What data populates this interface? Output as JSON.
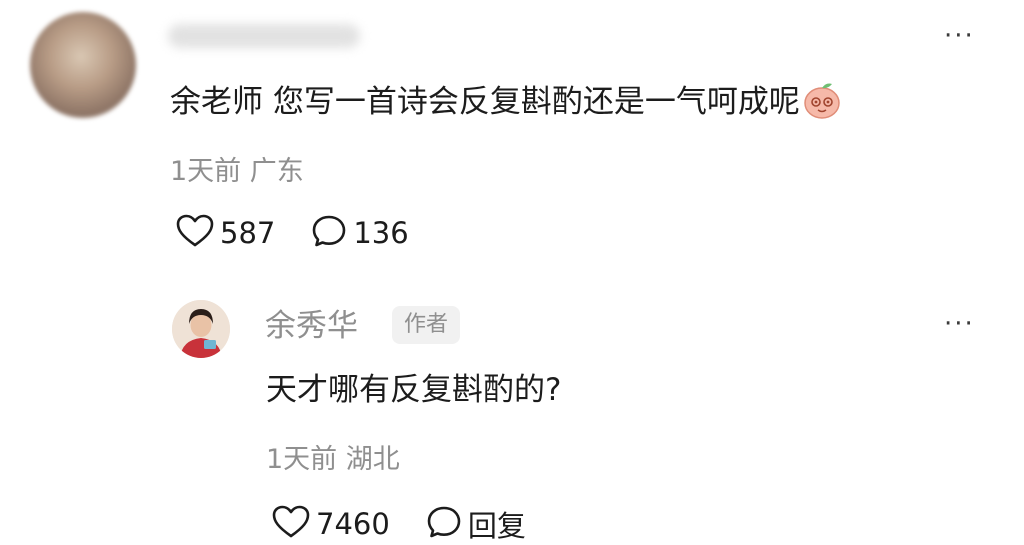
{
  "comment": {
    "avatar_icon": "blurred-user-avatar",
    "text": "余老师 您写一首诗会反复斟酌还是一气呵成呢",
    "emoji_icon": "peach-face-emoji-icon",
    "time": "1天前",
    "location": "广东",
    "likes": "587",
    "replies": "136",
    "more_label": "···"
  },
  "reply": {
    "author": "余秀华",
    "badge": "作者",
    "text": "天才哪有反复斟酌的?",
    "time": "1天前",
    "location": "湖北",
    "likes": "7460",
    "reply_label": "回复",
    "more_label": "···"
  },
  "colors": {
    "text_primary": "#1c1c1c",
    "text_secondary": "#8f8f8f",
    "badge_bg": "#f1f1f1"
  }
}
